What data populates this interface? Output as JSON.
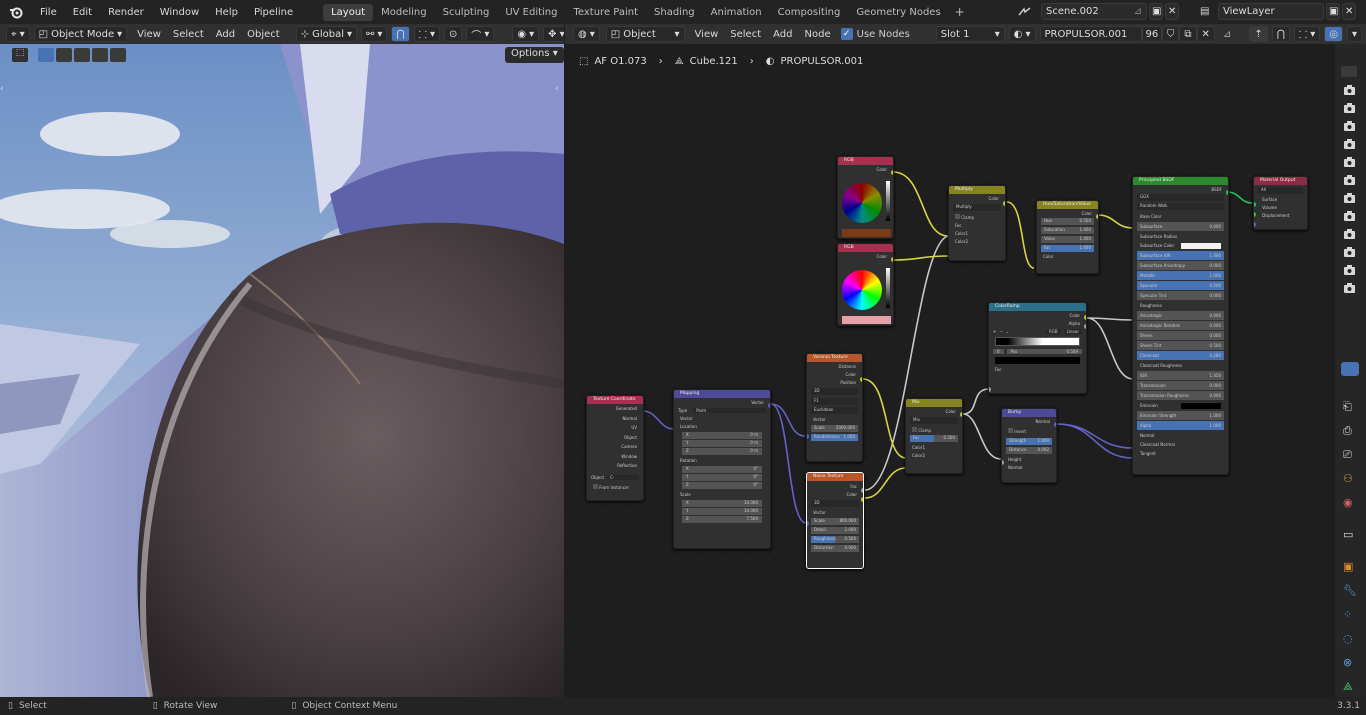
{
  "app": {
    "menus": [
      "File",
      "Edit",
      "Render",
      "Window",
      "Help",
      "Pipeline"
    ],
    "workspaces": [
      "Layout",
      "Modeling",
      "Sculpting",
      "UV Editing",
      "Texture Paint",
      "Shading",
      "Animation",
      "Compositing",
      "Geometry Nodes"
    ],
    "active_workspace": "Layout",
    "add_workspace": "+",
    "scene": "Scene.002",
    "view_layer": "ViewLayer"
  },
  "viewport_header": {
    "mode": "Object Mode",
    "menus": [
      "View",
      "Select",
      "Add",
      "Object"
    ],
    "transform": "Global",
    "options": "Options"
  },
  "node_header": {
    "editor_type": "Object",
    "menus": [
      "View",
      "Select",
      "Add",
      "Node"
    ],
    "use_nodes": "Use Nodes",
    "slot": "Slot 1",
    "material": "PROPULSOR.001",
    "users": "96"
  },
  "breadcrumb": [
    "AF O1.073",
    "Cube.121",
    "PROPULSOR.001"
  ],
  "nodes": {
    "rgb1": {
      "title": "RGB",
      "out": "Color"
    },
    "rgb2": {
      "title": "RGB",
      "out": "Color"
    },
    "multiply": {
      "title": "Multiply",
      "out": "Color",
      "blend": "Multiply",
      "clamp": "Clamp",
      "fac": "Fac",
      "c1": "Color1",
      "c2": "Color2"
    },
    "hsv": {
      "title": "Hue/Saturation/Value",
      "out": "Color",
      "hue": "Hue",
      "hue_v": "0.500",
      "sat": "Saturation",
      "sat_v": "1.000",
      "val": "Value",
      "val_v": "1.000",
      "fac": "Fac",
      "fac_v": "1.000",
      "color": "Color"
    },
    "bsdf": {
      "title": "Principled BSDF",
      "out": "BSDF",
      "dist": "GGX",
      "sss": "Random Walk",
      "rows": [
        [
          "Base Color",
          ""
        ],
        [
          "Subsurface",
          "0.000"
        ],
        [
          "Subsurface Radius",
          ""
        ],
        [
          "Subsurface Color",
          ""
        ],
        [
          "Subsurface IOR",
          "1.400"
        ],
        [
          "Subsurface Anisotropy",
          "0.000"
        ],
        [
          "Metallic",
          "1.000"
        ],
        [
          "Specular",
          "0.500"
        ],
        [
          "Specular Tint",
          "0.000"
        ],
        [
          "Roughness",
          ""
        ],
        [
          "Anisotropic",
          "0.000"
        ],
        [
          "Anisotropic Rotation",
          "0.000"
        ],
        [
          "Sheen",
          "0.000"
        ],
        [
          "Sheen Tint",
          "0.500"
        ],
        [
          "Clearcoat",
          "0.280"
        ],
        [
          "Clearcoat Roughness",
          ""
        ],
        [
          "IOR",
          "1.450"
        ],
        [
          "Transmission",
          "0.000"
        ],
        [
          "Transmission Roughness",
          "0.000"
        ],
        [
          "Emission",
          ""
        ],
        [
          "Emission Strength",
          "1.000"
        ],
        [
          "Alpha",
          "1.000"
        ],
        [
          "Normal",
          ""
        ],
        [
          "Clearcoat Normal",
          ""
        ],
        [
          "Tangent",
          ""
        ]
      ]
    },
    "output": {
      "title": "Material Output",
      "target": "All",
      "surface": "Surface",
      "volume": "Volume",
      "disp": "Displacement"
    },
    "ramp": {
      "title": "ColorRamp",
      "color": "Color",
      "alpha": "Alpha",
      "mode": "RGB",
      "interp": "Linear",
      "pos": "0",
      "pos_label": "Pos",
      "pos_v": "0.569",
      "fac": "Fac"
    },
    "voronoi": {
      "title": "Voronoi Texture",
      "dist": "Distance",
      "color": "Color",
      "pos": "Position",
      "dim": "3D",
      "feat": "F1",
      "metric": "Euclidean",
      "vector": "Vector",
      "scale": "Scale",
      "scale_v": "2000.000",
      "rand": "Randomness",
      "rand_v": "1.000"
    },
    "noise": {
      "title": "Noise Texture",
      "fac": "Fac",
      "color": "Color",
      "dim": "3D",
      "vector": "Vector",
      "scale": "Scale",
      "scale_v": "800.000",
      "detail": "Detail",
      "detail_v": "2.000",
      "rough": "Roughness",
      "rough_v": "0.500",
      "distort": "Distortion",
      "distort_v": "0.000"
    },
    "mix": {
      "title": "Mix",
      "color": "Color",
      "mode": "Mix",
      "clamp": "Clamp",
      "fac": "Fac",
      "fac_v": "0.500",
      "c1": "Color1",
      "c2": "Color2"
    },
    "bump": {
      "title": "Bump",
      "normal": "Normal",
      "invert": "Invert",
      "strength": "Strength",
      "strength_v": "1.000",
      "distance": "Distance",
      "distance_v": "0.002",
      "height": "Height",
      "normal_in": "Normal"
    },
    "texcoord": {
      "title": "Texture Coordinate",
      "outs": [
        "Generated",
        "Normal",
        "UV",
        "Object",
        "Camera",
        "Window",
        "Reflection"
      ],
      "object": "Object",
      "object_v": "C-",
      "from_inst": "From Instancer"
    },
    "mapping": {
      "title": "Mapping",
      "vector": "Vector",
      "type": "Type",
      "type_v": "Point",
      "vin": "Vector",
      "loc": "Location",
      "rot": "Rotation",
      "scale": "Scale",
      "loc_vals": [
        [
          "X",
          "0 m"
        ],
        [
          "Y",
          "0 m"
        ],
        [
          "Z",
          "0 m"
        ]
      ],
      "rot_vals": [
        [
          "X",
          "0°"
        ],
        [
          "Y",
          "0°"
        ],
        [
          "Z",
          "0°"
        ]
      ],
      "scale_vals": [
        [
          "X",
          "10.000"
        ],
        [
          "Y",
          "10.000"
        ],
        [
          "Z",
          "7.500"
        ]
      ]
    }
  },
  "status": {
    "select": "Select",
    "rotate": "Rotate View",
    "context": "Object Context Menu",
    "version": "3.3.1"
  },
  "colors": {
    "accent": "#4772b3",
    "rgb_header": "#a6314f",
    "tex_header": "#b7562a",
    "color_header": "#858420",
    "vec_header": "#4e4a97",
    "shader_header": "#2b8a2c",
    "output_header": "#8a2c43",
    "conv_header": "#2b6f8a",
    "link_yellow": "#d6d640",
    "link_purple": "#6363c7"
  }
}
